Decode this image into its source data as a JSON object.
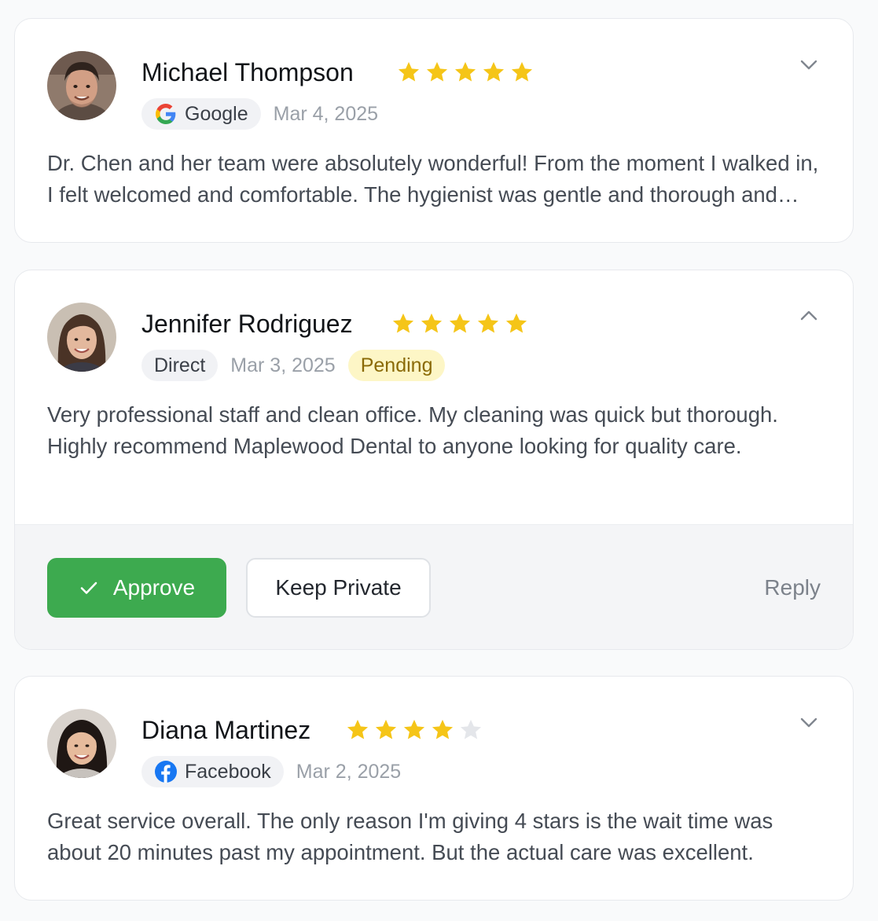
{
  "reviews": [
    {
      "name": "Michael Thompson",
      "rating": 5,
      "source": "Google",
      "source_icon": "google-icon",
      "date": "Mar 4, 2025",
      "text": "Dr. Chen and her team were absolutely wonderful! From the moment I walked in, I felt welcomed and comfortable. The hygienist was gentle and thorough and explained everything along the way.",
      "expanded": false
    },
    {
      "name": "Jennifer Rodriguez",
      "rating": 5,
      "source": "Direct",
      "source_icon": "",
      "date": "Mar 3, 2025",
      "status": "Pending",
      "text": "Very professional staff and clean office. My cleaning was quick but thorough. Highly recommend Maplewood Dental to anyone looking for quality care.",
      "expanded": true,
      "actions": {
        "approve_label": "Approve",
        "keep_private_label": "Keep Private",
        "reply_label": "Reply"
      }
    },
    {
      "name": "Diana Martinez",
      "rating": 4,
      "source": "Facebook",
      "source_icon": "facebook-icon",
      "date": "Mar 2, 2025",
      "text": "Great service overall. The only reason I'm giving 4 stars is the wait time was about 20 minutes past my appointment. But the actual care was excellent.",
      "expanded": false
    }
  ],
  "colors": {
    "star_filled": "#f5c518",
    "star_empty": "#e4e6ea",
    "approve": "#3daa4f",
    "pending_bg": "#fdf6c6",
    "pending_text": "#8a6a06"
  }
}
